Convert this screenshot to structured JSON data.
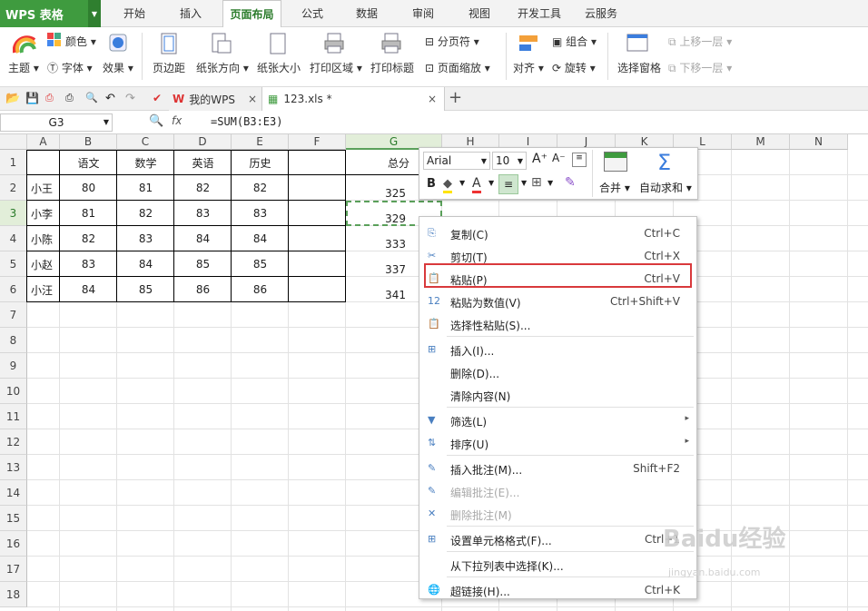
{
  "app": {
    "name": "WPS 表格"
  },
  "menu": {
    "tabs": [
      "开始",
      "插入",
      "页面布局",
      "公式",
      "数据",
      "审阅",
      "视图",
      "开发工具",
      "云服务"
    ],
    "active": "页面布局"
  },
  "ribbon": {
    "theme": "主题",
    "colors": "颜色",
    "font": "字体",
    "effects": "效果",
    "margins": "页边距",
    "orientation": "纸张方向",
    "size": "纸张大小",
    "print_area": "打印区域",
    "print_titles": "打印标题",
    "page_break": "分页符",
    "page_zoom": "页面缩放",
    "align": "对齐",
    "group": "组合",
    "rotate": "旋转",
    "selection_pane": "选择窗格",
    "bring_forward": "上移一层",
    "send_backward": "下移一层"
  },
  "doctabs": [
    {
      "label": "我的WPS"
    },
    {
      "label": "123.xls *"
    }
  ],
  "formula_bar": {
    "name_box": "G3",
    "fx": "fx",
    "formula": "=SUM(B3:E3)"
  },
  "columns": [
    "A",
    "B",
    "C",
    "D",
    "E",
    "F",
    "G",
    "H",
    "I",
    "J",
    "K",
    "L",
    "M",
    "N"
  ],
  "rows": [
    "1",
    "2",
    "3",
    "4",
    "5",
    "6",
    "7",
    "8",
    "9",
    "10",
    "11",
    "12",
    "13",
    "14",
    "15",
    "16",
    "17",
    "18"
  ],
  "table": {
    "headers": [
      "语文",
      "数学",
      "英语",
      "历史"
    ],
    "names": [
      "小王",
      "小李",
      "小陈",
      "小赵",
      "小汪"
    ],
    "scores": [
      [
        "80",
        "81",
        "82",
        "82"
      ],
      [
        "81",
        "82",
        "83",
        "83"
      ],
      [
        "82",
        "83",
        "84",
        "84"
      ],
      [
        "83",
        "84",
        "85",
        "85"
      ],
      [
        "84",
        "85",
        "86",
        "86"
      ]
    ],
    "total_header": "总分",
    "totals": [
      "325",
      "329",
      "333",
      "337",
      "341"
    ]
  },
  "mini_toolbar": {
    "font": "Arial",
    "size": "10",
    "merge": "合并",
    "autosum": "自动求和",
    "bold": "B",
    "font_color_letter": "A"
  },
  "context_menu": [
    {
      "label": "复制(C)",
      "shortcut": "Ctrl+C"
    },
    {
      "label": "剪切(T)",
      "shortcut": "Ctrl+X"
    },
    {
      "label": "粘贴(P)",
      "shortcut": "Ctrl+V"
    },
    {
      "label": "粘贴为数值(V)",
      "shortcut": "Ctrl+Shift+V"
    },
    {
      "label": "选择性粘贴(S)...",
      "shortcut": ""
    },
    {
      "label": "插入(I)...",
      "shortcut": ""
    },
    {
      "label": "删除(D)...",
      "shortcut": ""
    },
    {
      "label": "清除内容(N)",
      "shortcut": ""
    },
    {
      "label": "筛选(L)",
      "shortcut": ""
    },
    {
      "label": "排序(U)",
      "shortcut": ""
    },
    {
      "label": "插入批注(M)...",
      "shortcut": "Shift+F2"
    },
    {
      "label": "编辑批注(E)...",
      "shortcut": ""
    },
    {
      "label": "删除批注(M)",
      "shortcut": ""
    },
    {
      "label": "设置单元格格式(F)...",
      "shortcut": "Ctrl+1"
    },
    {
      "label": "从下拉列表中选择(K)...",
      "shortcut": ""
    },
    {
      "label": "超链接(H)...",
      "shortcut": "Ctrl+K"
    }
  ],
  "colors": {
    "accent_green": "#3f9b3f",
    "highlight_red": "#d9393c",
    "selection_green": "#5aa05a"
  },
  "watermark": {
    "brand": "Baidu经验",
    "url": "jingyan.baidu.com"
  }
}
